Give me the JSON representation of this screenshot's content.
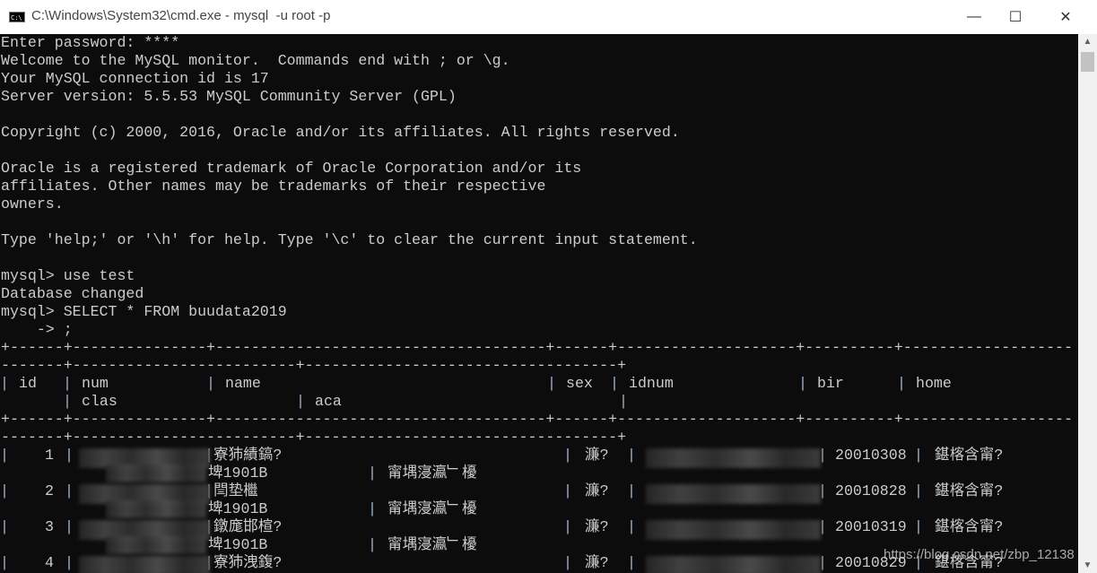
{
  "window": {
    "title": "C:\\Windows\\System32\\cmd.exe - mysql  -u root -p",
    "icon_label": "C:\\",
    "minimize_glyph": "—",
    "maximize_glyph": "☐",
    "close_glyph": "✕"
  },
  "terminal": {
    "lines": [
      "Enter password: ****",
      "Welcome to the MySQL monitor.  Commands end with ; or \\g.",
      "Your MySQL connection id is 17",
      "Server version: 5.5.53 MySQL Community Server (GPL)",
      "",
      "Copyright (c) 2000, 2016, Oracle and/or its affiliates. All rights reserved.",
      "",
      "Oracle is a registered trademark of Oracle Corporation and/or its",
      "affiliates. Other names may be trademarks of their respective",
      "owners.",
      "",
      "Type 'help;' or '\\h' for help. Type '\\c' to clear the current input statement.",
      "",
      "mysql> use test",
      "Database changed",
      "mysql> SELECT * FROM buudata2019",
      "    -> ;"
    ],
    "separator_a": "+------+---------------+-------------------------------------+------+--------------------+----------+-------------------",
    "separator_b": "-------+-------------------------+-----------------------------------+",
    "headers": {
      "id": "id",
      "num": "num",
      "name": "name",
      "sex": "sex",
      "idnum": "idnum",
      "bir": "bir",
      "home": "home",
      "clas": "clas",
      "aca": "aca"
    },
    "rows": [
      {
        "id": "1",
        "name": "寮犻績鎬?",
        "sex": "濂?",
        "bir": "20010308",
        "home": "鍖楁含甯?",
        "clas": "埤1901B",
        "aca": "甯堣寖瀛﹂櫌"
      },
      {
        "id": "2",
        "name": "閆垫檵",
        "sex": "濂?",
        "bir": "20010828",
        "home": "鍖楁含甯?",
        "clas": "埤1901B",
        "aca": "甯堣寖瀛﹂櫌"
      },
      {
        "id": "3",
        "name": "鐓庬邯楦?",
        "sex": "濂?",
        "bir": "20010319",
        "home": "鍖楁含甯?",
        "clas": "埤1901B",
        "aca": "甯堣寖瀛﹂櫌"
      },
      {
        "id": "4",
        "name": "寮犻洩鍑?",
        "sex": "濂?",
        "bir": "20010829",
        "home": "鍖楁含甯?"
      }
    ]
  },
  "watermark": "https://blog.csdn.net/zbp_12138",
  "scrollbar": {
    "up": "▲",
    "down": "▼",
    "position": 0.0
  }
}
